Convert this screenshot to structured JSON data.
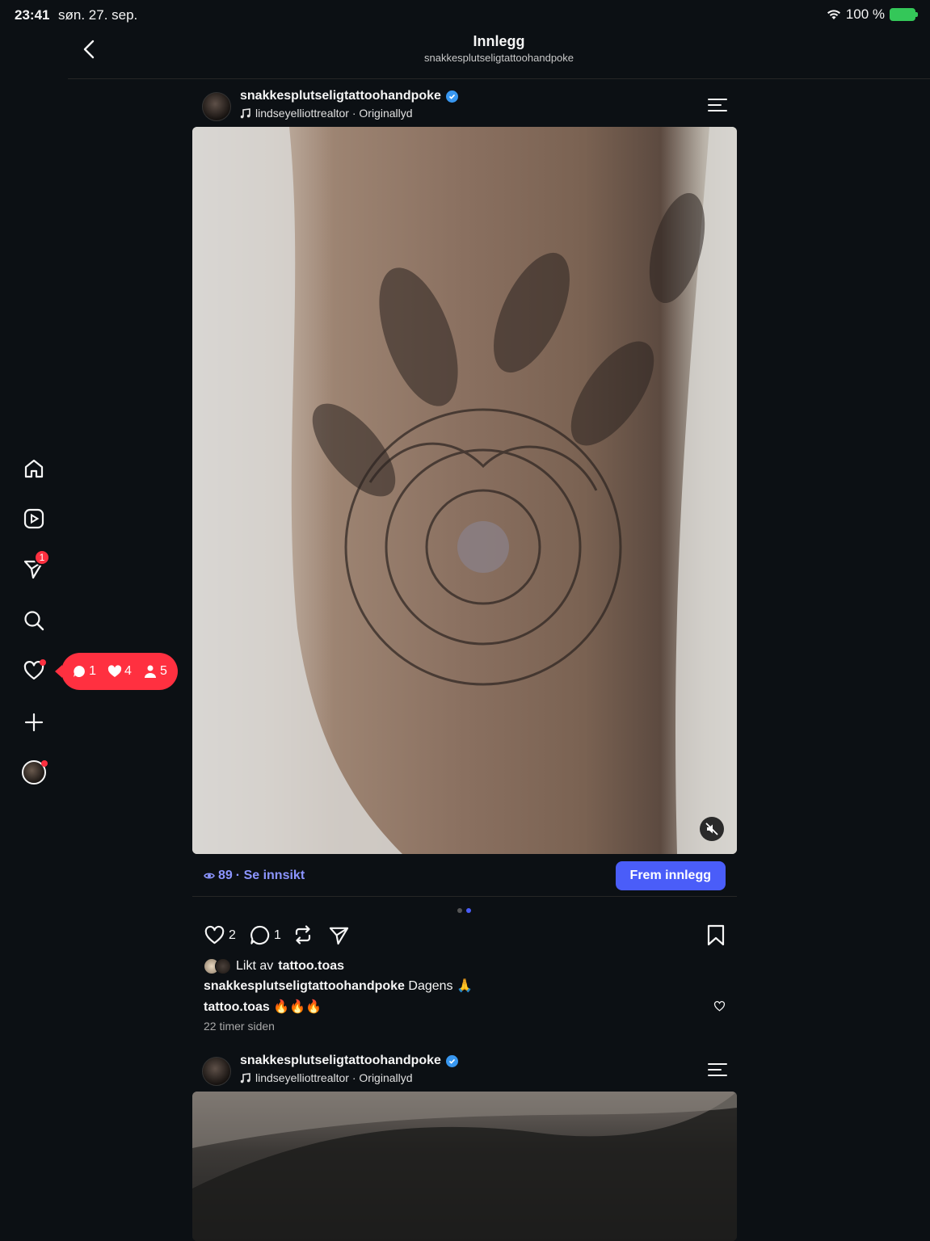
{
  "status_bar": {
    "time": "23:41",
    "date": "søn. 27. sep.",
    "battery": "100 %"
  },
  "header": {
    "title": "Innlegg",
    "subtitle": "snakkesplutseligtattoohandpoke"
  },
  "sidebar": {
    "items": [
      "home-icon",
      "reels-icon",
      "direct-icon",
      "search-icon",
      "heart-icon",
      "create-icon",
      "profile-avatar"
    ],
    "direct_badge": "1",
    "notifications": {
      "comments": "1",
      "likes": "4",
      "followers": "5"
    }
  },
  "posts": [
    {
      "username": "snakkesplutseligtattoohandpoke",
      "audio": "lindseyelliottrealtor · Originallyd",
      "views": "89",
      "insights_label": "· Se innsikt",
      "boost_label": "Frem innlegg",
      "like_count": "2",
      "comment_count": "1",
      "liked_by_prefix": "Likt av",
      "liked_by_user": "tattoo.toas",
      "caption_user": "snakkesplutseligtattoohandpoke",
      "caption_text": "Dagens 🙏",
      "comment_user": "tattoo.toas",
      "comment_text": "🔥🔥🔥",
      "timestamp": "22 timer siden"
    },
    {
      "username": "snakkesplutseligtattoohandpoke",
      "audio": "lindseyelliottrealtor · Originallyd"
    }
  ],
  "colors": {
    "accent": "#4a5df9",
    "badge": "#ff3040",
    "background": "#0c1014"
  }
}
